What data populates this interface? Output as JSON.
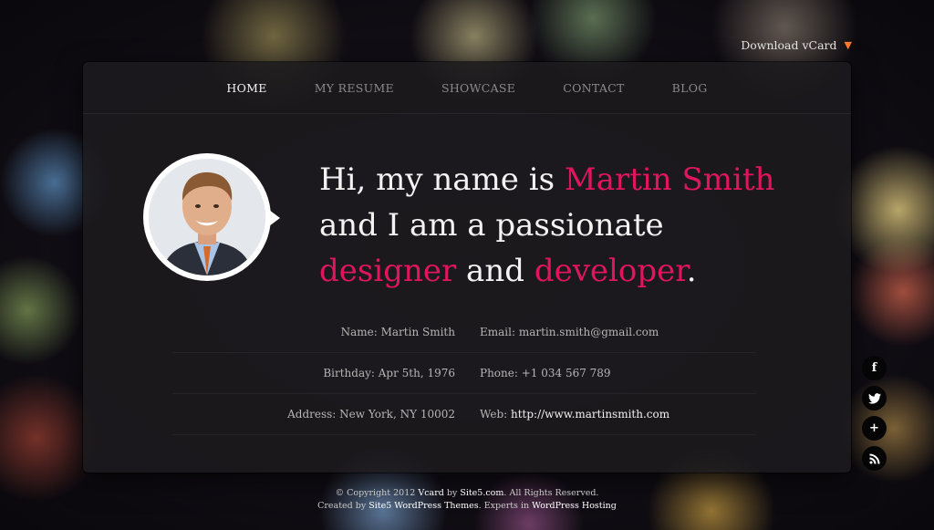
{
  "header": {
    "download_label": "Download vCard"
  },
  "nav": {
    "items": [
      {
        "label": "HOME"
      },
      {
        "label": "MY RESUME"
      },
      {
        "label": "SHOWCASE"
      },
      {
        "label": "CONTACT"
      },
      {
        "label": "BLOG"
      }
    ]
  },
  "intro": {
    "line1_prefix": "Hi, my name is ",
    "name": "Martin Smith",
    "line2": "and I am a passionate",
    "role1": "designer",
    "and_word": " and ",
    "role2": "developer",
    "period": "."
  },
  "info": {
    "rows": [
      {
        "left": "Name: Martin Smith",
        "right": "Email: martin.smith@gmail.com"
      },
      {
        "left": "Birthday: Apr 5th, 1976",
        "right": "Phone: +1 034 567 789"
      },
      {
        "left": "Address: New York, NY 10002",
        "right_prefix": "Web: ",
        "right_link": "http://www.martinsmith.com"
      }
    ]
  },
  "socials": [
    {
      "icon": "facebook-icon",
      "glyph": "f"
    },
    {
      "icon": "twitter-icon",
      "glyph": "t"
    },
    {
      "icon": "plus-icon",
      "glyph": "+"
    },
    {
      "icon": "rss-icon",
      "glyph": ")"
    }
  ],
  "footer": {
    "line1_a": "© Copyright 2012 ",
    "line1_brand": "Vcard",
    "line1_b": " by ",
    "line1_site": "Site5.com",
    "line1_c": ". All Rights Reserved.",
    "line2_a": "Created by ",
    "line2_site": "Site5 WordPress Themes",
    "line2_b": ". Experts in ",
    "line2_hosting": "WordPress Hosting"
  },
  "colors": {
    "accent": "#e0155e",
    "download_arrow": "#ff7a2f"
  }
}
